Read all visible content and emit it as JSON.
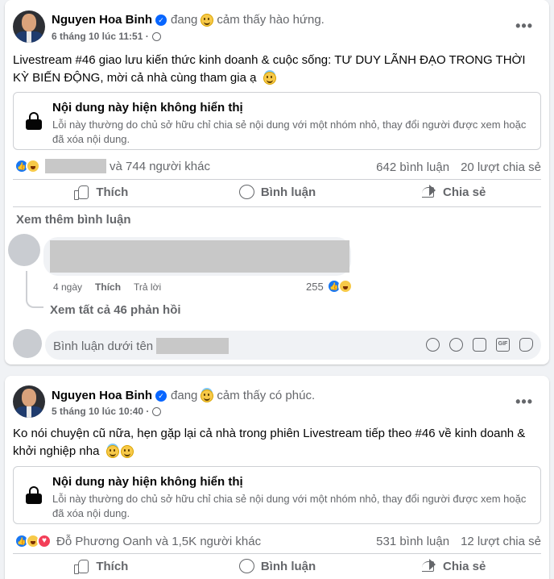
{
  "colors": {
    "accent": "#0866ff",
    "text_secondary": "#65676b",
    "background": "#f0f2f5"
  },
  "posts": [
    {
      "author": "Nguyen Hoa Binh",
      "verified_icon": "verified-badge-icon",
      "feeling_prefix": "đang",
      "feeling_text": "cảm thấy hào hứng.",
      "timestamp": "6 tháng 10 lúc 11:51 ·",
      "text": "Livestream #46 giao lưu kiến thức kinh doanh & cuộc sống: TƯ DUY LÃNH ĐẠO TRONG THỜI KỲ BIẾN ĐỘNG, mời cả nhà cùng tham gia ạ",
      "unavailable_title": "Nội dung này hiện không hiển thị",
      "unavailable_desc": "Lỗi này thường do chủ sở hữu chỉ chia sẻ nội dung với một nhóm nhỏ, thay đổi người được xem hoặc đã xóa nội dung.",
      "reactions_text": "và 744 người khác",
      "comments_count": "642 bình luận",
      "shares_count": "20 lượt chia sẻ",
      "actions": {
        "like": "Thích",
        "comment": "Bình luận",
        "share": "Chia sẻ"
      },
      "see_more_comments": "Xem thêm bình luận",
      "comment": {
        "time": "4 ngày",
        "like": "Thích",
        "reply": "Trả lời",
        "reaction_count": "255"
      },
      "view_replies": "Xem tất cả 46 phản hồi",
      "comment_placeholder": "Bình luận dưới tên"
    },
    {
      "author": "Nguyen Hoa Binh",
      "verified_icon": "verified-badge-icon",
      "feeling_prefix": "đang",
      "feeling_text": "cảm thấy có phúc.",
      "timestamp": "5 tháng 10 lúc 10:40 ·",
      "text": "Ko nói chuyện cũ nữa, hẹn gặp lại cả nhà trong phiên Livestream tiếp theo #46 về kinh doanh & khởi nghiệp nha",
      "unavailable_title": "Nội dung này hiện không hiển thị",
      "unavailable_desc": "Lỗi này thường do chủ sở hữu chỉ chia sẻ nội dung với một nhóm nhỏ, thay đổi người được xem hoặc đã xóa nội dung.",
      "reactions_text": "Đỗ Phương Oanh và 1,5K người khác",
      "comments_count": "531 bình luận",
      "shares_count": "12 lượt chia sẻ",
      "actions": {
        "like": "Thích",
        "comment": "Bình luận",
        "share": "Chia sẻ"
      }
    }
  ]
}
